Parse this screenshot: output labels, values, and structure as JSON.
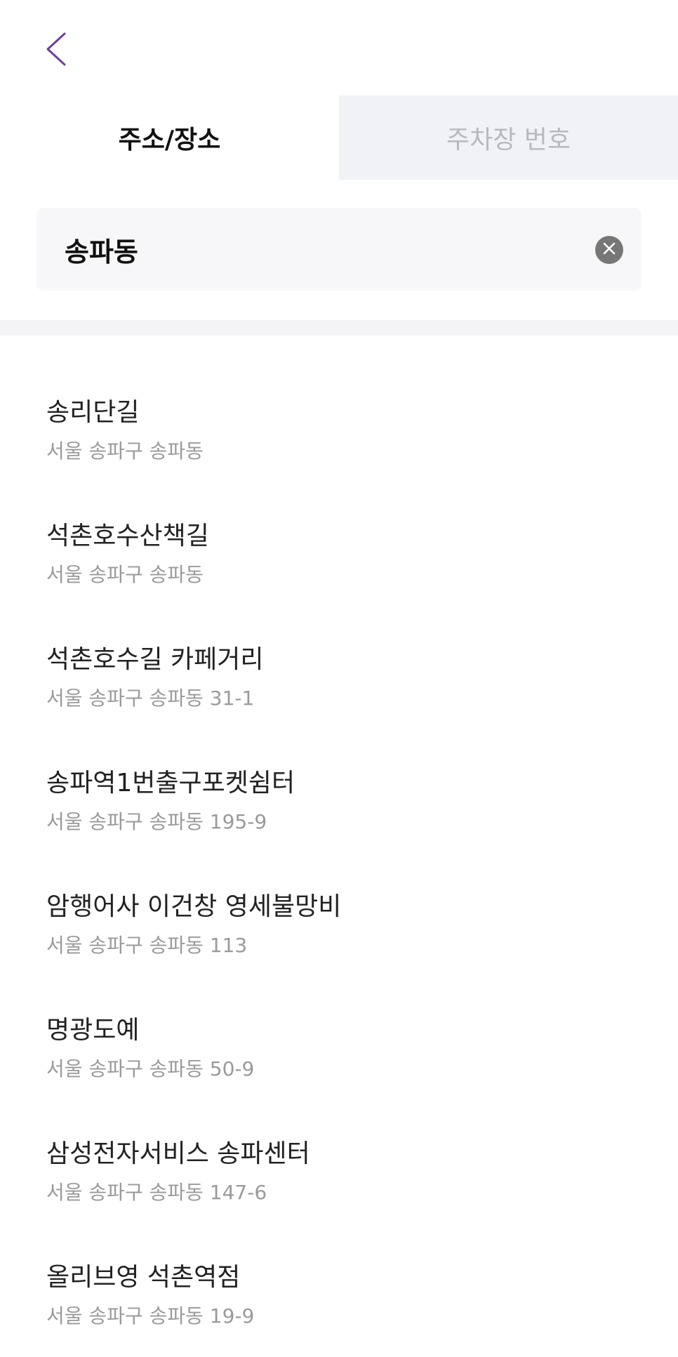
{
  "header": {
    "back_icon": "chevron-left-icon",
    "accent_color": "#6b3fa0"
  },
  "tabs": [
    {
      "label": "주소/장소",
      "active": true
    },
    {
      "label": "주차장 번호",
      "active": false
    }
  ],
  "search": {
    "value": "송파동",
    "clear_icon": "clear-circle-icon"
  },
  "results": [
    {
      "name": "송리단길",
      "address": "서울 송파구 송파동"
    },
    {
      "name": "석촌호수산책길",
      "address": "서울 송파구 송파동"
    },
    {
      "name": "석촌호수길 카페거리",
      "address": "서울 송파구 송파동 31-1"
    },
    {
      "name": "송파역1번출구포켓쉼터",
      "address": "서울 송파구 송파동 195-9"
    },
    {
      "name": "암행어사 이건창 영세불망비",
      "address": "서울 송파구 송파동 113"
    },
    {
      "name": "명광도예",
      "address": "서울 송파구 송파동 50-9"
    },
    {
      "name": "삼성전자서비스 송파센터",
      "address": "서울 송파구 송파동 147-6"
    },
    {
      "name": "올리브영 석촌역점",
      "address": "서울 송파구 송파동 19-9"
    }
  ]
}
